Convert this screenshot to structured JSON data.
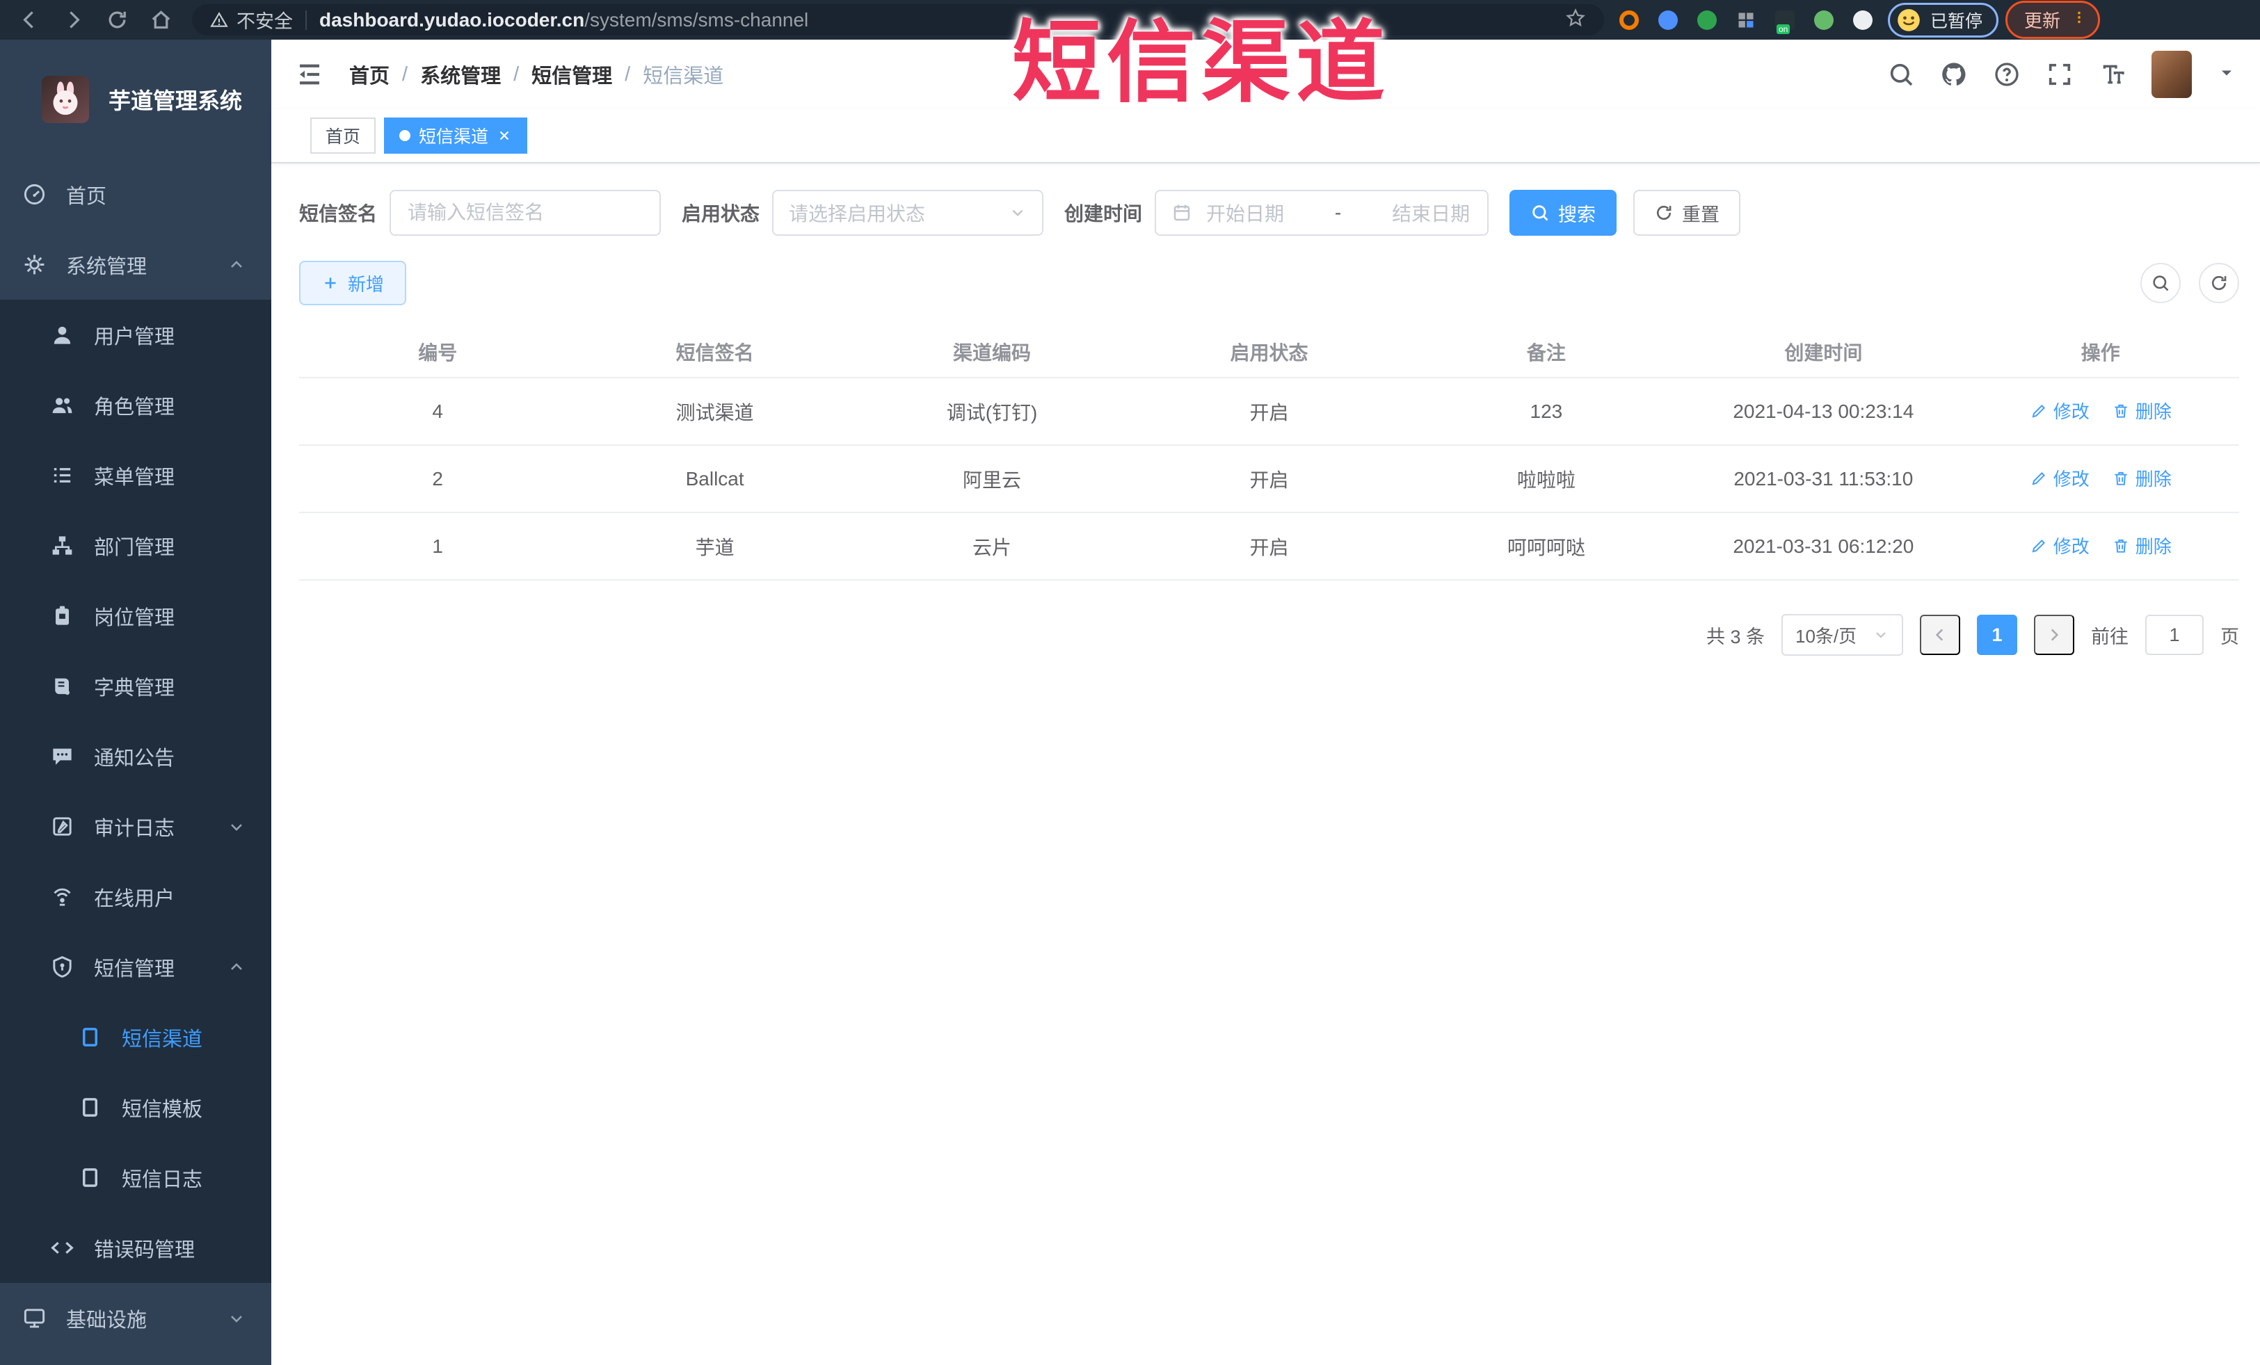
{
  "browser": {
    "security_label": "不安全",
    "url_host": "dashboard.yudao.iocoder.cn",
    "url_path": "/system/sms/sms-channel",
    "paused_label": "已暂停",
    "update_label": "更新",
    "extensions": [
      {
        "icon": "extension-orange-ring-icon",
        "color": "#f57c00",
        "shape": "ring"
      },
      {
        "icon": "extension-location-icon",
        "color": "#4d90fe",
        "shape": "circle"
      },
      {
        "icon": "extension-green-check-icon",
        "color": "#2ea44f",
        "shape": "circle"
      },
      {
        "icon": "extension-grid-icon",
        "color": "#9aa0a6",
        "shape": "grid"
      },
      {
        "icon": "extension-on-badge-icon",
        "color": "#24c364",
        "shape": "tag"
      },
      {
        "icon": "extension-leaf-icon",
        "color": "#66bb6a",
        "shape": "circle"
      },
      {
        "icon": "extension-puzzle-icon",
        "color": "#eceff1",
        "shape": "circle"
      }
    ]
  },
  "annotation": {
    "text": "短信渠道",
    "color": "#f0355c"
  },
  "sidebar": {
    "logo_title": "芋道管理系统",
    "menu": [
      {
        "label": "首页",
        "icon": "dashboard-icon",
        "level": 1
      },
      {
        "label": "系统管理",
        "icon": "gear-icon",
        "level": 1,
        "chevron": "up"
      },
      {
        "label": "用户管理",
        "icon": "user-icon",
        "level": 2
      },
      {
        "label": "角色管理",
        "icon": "users-icon",
        "level": 2
      },
      {
        "label": "菜单管理",
        "icon": "menu-list-icon",
        "level": 2
      },
      {
        "label": "部门管理",
        "icon": "org-tree-icon",
        "level": 2
      },
      {
        "label": "岗位管理",
        "icon": "post-badge-icon",
        "level": 2
      },
      {
        "label": "字典管理",
        "icon": "dictionary-icon",
        "level": 2
      },
      {
        "label": "通知公告",
        "icon": "announcement-icon",
        "level": 2
      },
      {
        "label": "审计日志",
        "icon": "audit-log-icon",
        "level": 2,
        "chevron": "down"
      },
      {
        "label": "在线用户",
        "icon": "online-users-icon",
        "level": 2
      },
      {
        "label": "短信管理",
        "icon": "sms-shield-icon",
        "level": 2,
        "chevron": "up"
      },
      {
        "label": "短信渠道",
        "icon": "doc-icon",
        "level": 3,
        "active": true
      },
      {
        "label": "短信模板",
        "icon": "doc-icon",
        "level": 3
      },
      {
        "label": "短信日志",
        "icon": "doc-icon",
        "level": 3
      },
      {
        "label": "错误码管理",
        "icon": "code-icon",
        "level": 2
      },
      {
        "label": "基础设施",
        "icon": "monitor-icon",
        "level": 1,
        "chevron": "down"
      }
    ]
  },
  "navbar": {
    "breadcrumb": [
      "首页",
      "系统管理",
      "短信管理",
      "短信渠道"
    ],
    "action_icons": [
      "search-icon",
      "github-icon",
      "help-icon",
      "fullscreen-icon",
      "font-size-icon"
    ]
  },
  "tabs": [
    {
      "label": "首页",
      "active": false
    },
    {
      "label": "短信渠道",
      "active": true,
      "closable": true
    }
  ],
  "filters": {
    "sign_label": "短信签名",
    "sign_placeholder": "请输入短信签名",
    "status_label": "启用状态",
    "status_placeholder": "请选择启用状态",
    "time_label": "创建时间",
    "date_start": "开始日期",
    "date_sep": "-",
    "date_end": "结束日期",
    "search_label": "搜索",
    "reset_label": "重置"
  },
  "toolbar": {
    "add_label": "新增"
  },
  "table": {
    "headers": [
      "编号",
      "短信签名",
      "渠道编码",
      "启用状态",
      "备注",
      "创建时间",
      "操作"
    ],
    "rows": [
      [
        "4",
        "测试渠道",
        "调试(钉钉)",
        "开启",
        "123",
        "2021-04-13 00:23:14"
      ],
      [
        "2",
        "Ballcat",
        "阿里云",
        "开启",
        "啦啦啦",
        "2021-03-31 11:53:10"
      ],
      [
        "1",
        "芋道",
        "云片",
        "开启",
        "呵呵呵哒",
        "2021-03-31 06:12:20"
      ]
    ],
    "edit_label": "修改",
    "delete_label": "删除"
  },
  "pagination": {
    "total": "共 3 条",
    "page_size": "10条/页",
    "current_page": "1",
    "goto_label": "前往",
    "goto_value": "1",
    "unit_label": "页"
  },
  "colors": {
    "primary": "#409EFF",
    "sidebar_bg": "#304156",
    "submenu_bg": "#1f2d3d",
    "annotation": "#f0355c"
  }
}
